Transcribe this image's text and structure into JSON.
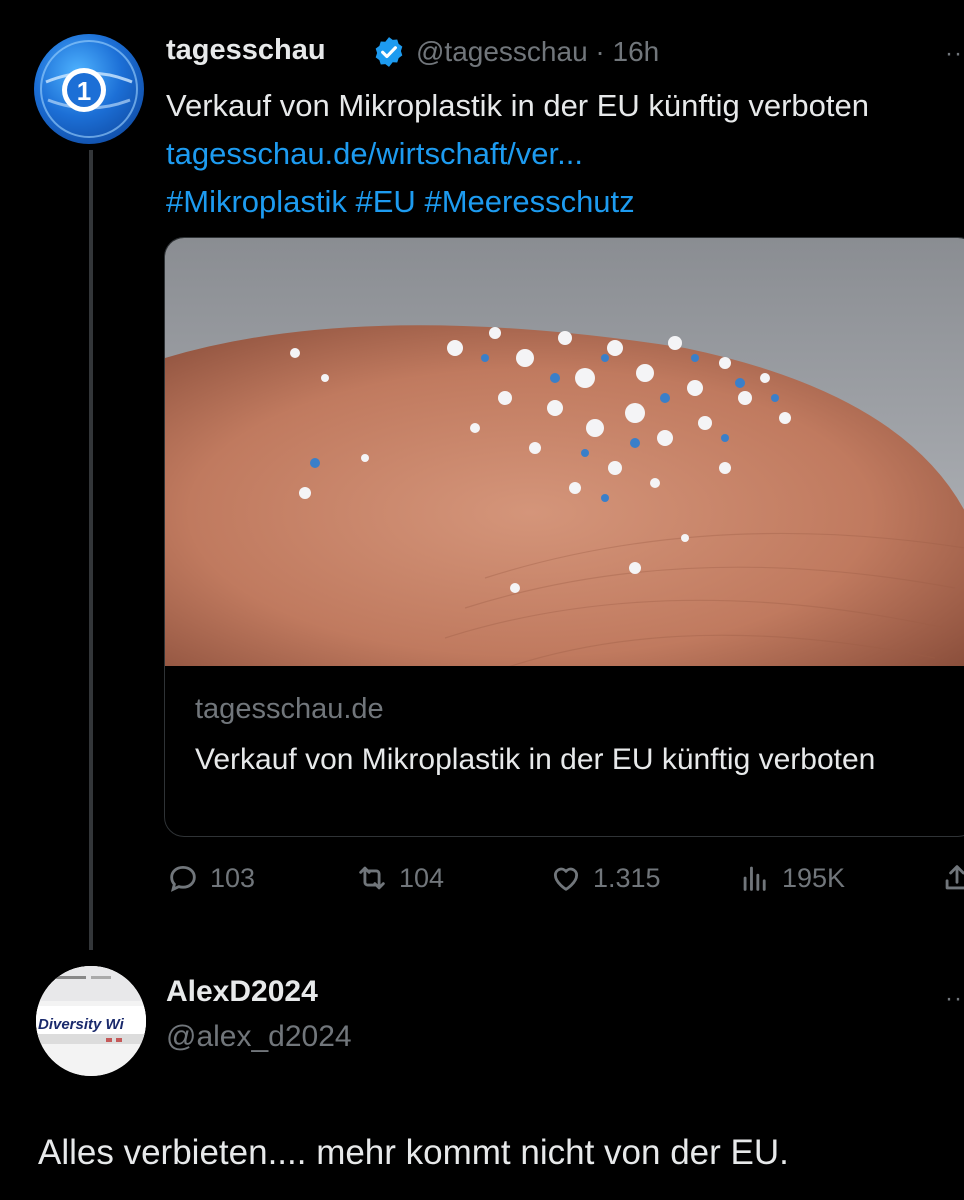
{
  "tweet": {
    "display_name": "tagesschau",
    "handle": "@tagesschau",
    "separator": " · ",
    "time": "16h",
    "text": "Verkauf von Mikroplastik in der EU künftig verboten",
    "link": "tagesschau.de/wirtschaft/ver...",
    "hashtags": [
      "#Mikroplastik",
      "#EU",
      "#Meeresschutz"
    ],
    "card": {
      "image_alt_icon": "microplastic-on-fingertip-photo",
      "domain": "tagesschau.de",
      "title": "Verkauf von Mikroplastik in der EU künftig verboten"
    },
    "actions": {
      "replies": "103",
      "retweets": "104",
      "likes": "1.315",
      "views": "195K"
    },
    "more_icon": "more-icon"
  },
  "reply": {
    "display_name": "AlexD2024",
    "handle": "@alex_d2024",
    "avatar_text": "Diversity Wi",
    "text": "Alles verbieten.... mehr kommt nicht von der EU."
  },
  "colors": {
    "background": "#000000",
    "text": "#e7e9ea",
    "muted": "#71767b",
    "link": "#1d9bf0",
    "border": "#2f3336"
  }
}
